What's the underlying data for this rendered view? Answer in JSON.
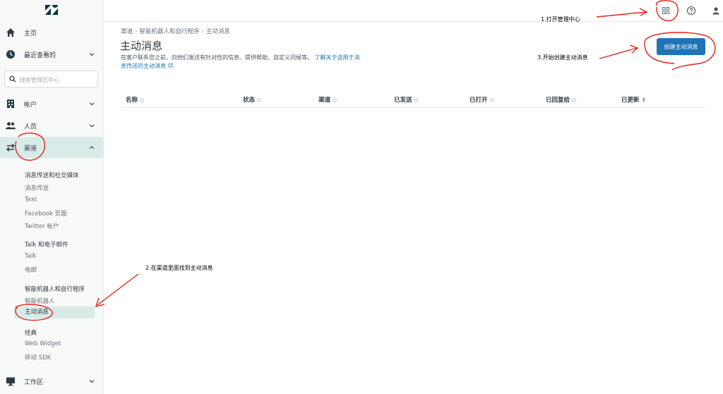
{
  "sidebar": {
    "logo": "zendesk-logo",
    "home": "主页",
    "recent": "最近查看的",
    "search_placeholder": "搜索管理员中心",
    "account": "帐户",
    "people": "人员",
    "channels": "渠道",
    "workspaces": "工作区",
    "groups": [
      {
        "title": "消息传送和社交媒体",
        "items": [
          "消息传送",
          "Text",
          "Facebook 页面",
          "Twitter 帐户"
        ]
      },
      {
        "title": "Talk 和电子邮件",
        "items": [
          "Talk",
          "电邮"
        ]
      },
      {
        "title": "智能机器人和自行程序",
        "items": [
          "智能机器人",
          "主动消息"
        ]
      },
      {
        "title": "经典",
        "items": [
          "Web Widget",
          "移动 SDK"
        ]
      }
    ]
  },
  "topbar": {
    "icons": [
      "products-grid-icon",
      "help-icon",
      "user-icon"
    ]
  },
  "main": {
    "breadcrumb": [
      "渠道",
      "智能机器人和自行程序",
      "主动消息"
    ],
    "title": "主动消息",
    "description": "在客户联系您之前，向他们发送有针对性的信息、提供帮助、自定义问候等。",
    "learn_more": "了解关于适用于消息传送的主动消息",
    "create_button": "创建主动消息",
    "columns": [
      "名称",
      "状态",
      "渠道",
      "已发送",
      "已打开",
      "已回复给",
      "已更新"
    ]
  },
  "annotations": {
    "step1": "1.打开管理中心",
    "step2": "2.在渠道里面找到主动消息",
    "step3": "3.开始创建主动消息"
  },
  "colors": {
    "accent": "#1f73b7",
    "active_bg": "#d9ebe8",
    "annotation": "#e2231a"
  }
}
